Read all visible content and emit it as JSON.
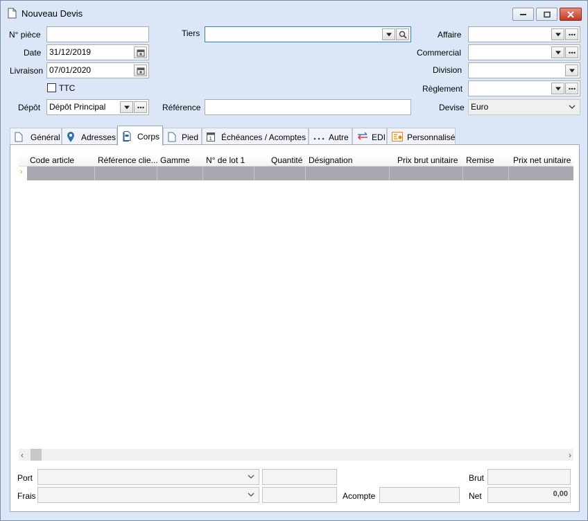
{
  "window": {
    "title": "Nouveau Devis"
  },
  "header": {
    "piece_label": "N° pièce",
    "piece_value": "",
    "date_label": "Date",
    "date_value": "31/12/2019",
    "livraison_label": "Livraison",
    "livraison_value": "07/01/2020",
    "ttc_label": "TTC",
    "ttc_checked": false,
    "depot_label": "Dépôt",
    "depot_value": "Dépôt Principal",
    "tiers_label": "Tiers",
    "tiers_value": "",
    "reference_label": "Référence",
    "reference_value": "",
    "affaire_label": "Affaire",
    "affaire_value": "",
    "commercial_label": "Commercial",
    "commercial_value": "",
    "division_label": "Division",
    "division_value": "",
    "reglement_label": "Règlement",
    "reglement_value": "",
    "devise_label": "Devise",
    "devise_value": "Euro"
  },
  "tabs": [
    {
      "label": "Général",
      "icon": "document-icon"
    },
    {
      "label": "Adresses",
      "icon": "map-pin-icon"
    },
    {
      "label": "Corps",
      "icon": "pages-icon",
      "active": true
    },
    {
      "label": "Pied",
      "icon": "document-icon"
    },
    {
      "label": "Échéances / Acomptes",
      "icon": "calendar-icon"
    },
    {
      "label": "Autre",
      "icon": "ellipsis-icon"
    },
    {
      "label": "EDI",
      "icon": "exchange-arrows-icon"
    },
    {
      "label": "Personnalisé",
      "icon": "custom-fields-icon"
    }
  ],
  "grid": {
    "columns": [
      "Code article",
      "Référence clie...",
      "Gamme",
      "N° de lot 1",
      "Quantité",
      "Désignation",
      "Prix brut unitaire",
      "Remise",
      "Prix net unitaire"
    ],
    "row_indicator": "›"
  },
  "footer": {
    "port_label": "Port",
    "port_value": "",
    "frais_label": "Frais",
    "frais_value": "",
    "acompte_label": "Acompte",
    "acompte_value": "",
    "brut_label": "Brut",
    "brut_value": "",
    "net_label": "Net",
    "net_value": "0,00"
  },
  "colors": {
    "window_bg": "#dbe7f6",
    "grid_row": "#a7a7b0",
    "accent": "#3c7fb1"
  }
}
